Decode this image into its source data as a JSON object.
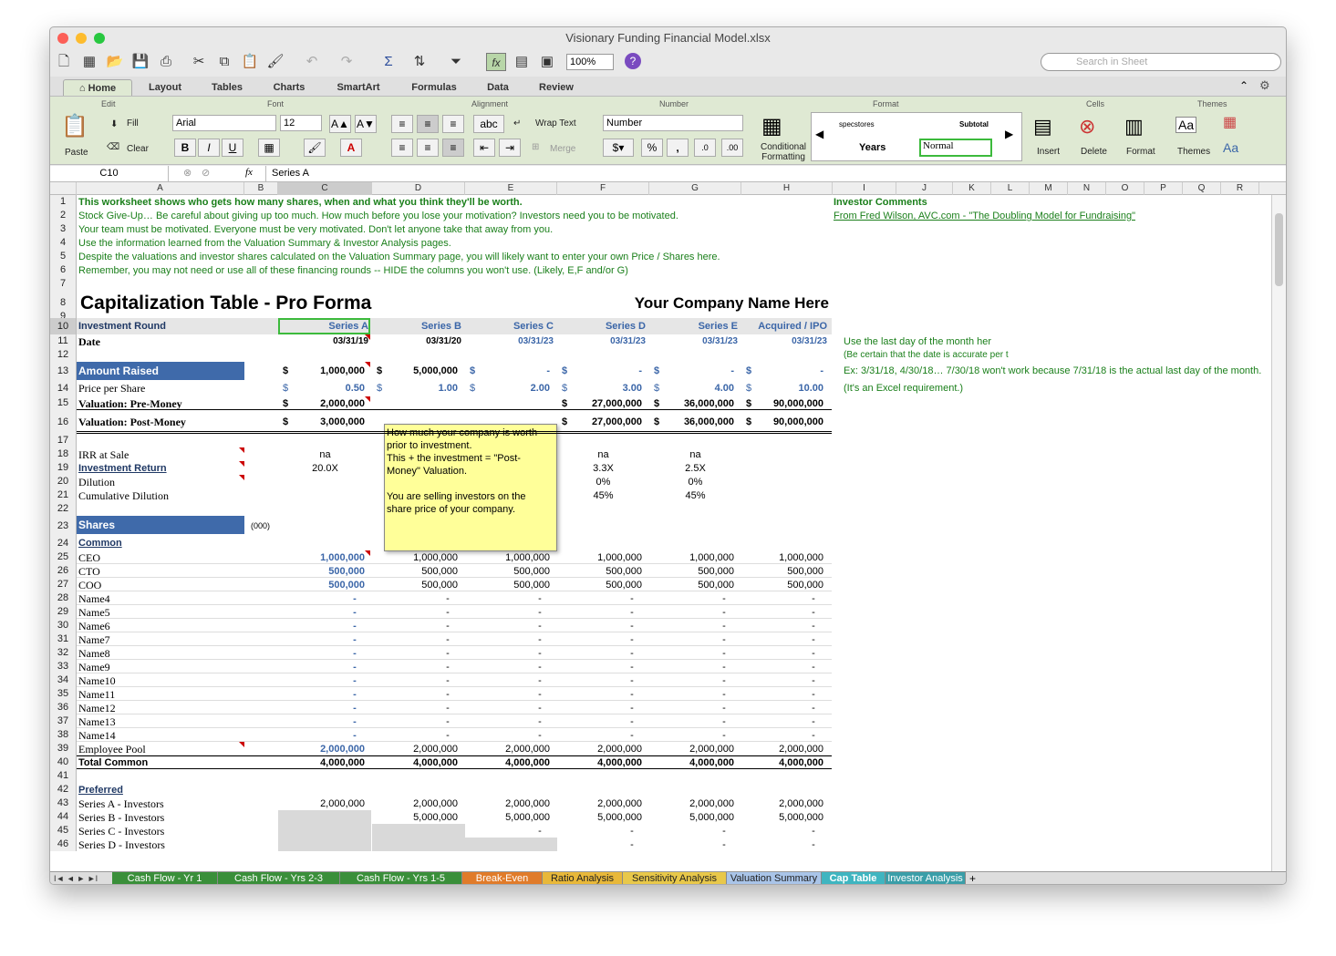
{
  "window": {
    "title": "Visionary Funding Financial Model.xlsx"
  },
  "toolbar": {
    "zoom": "100%",
    "search_placeholder": "Search in Sheet"
  },
  "tabs": [
    "Home",
    "Layout",
    "Tables",
    "Charts",
    "SmartArt",
    "Formulas",
    "Data",
    "Review"
  ],
  "ribbon": {
    "groups": {
      "edit": "Edit",
      "font": "Font",
      "alignment": "Alignment",
      "number": "Number",
      "format": "Format",
      "cells": "Cells",
      "themes": "Themes"
    },
    "paste": "Paste",
    "fill": "Fill",
    "clear": "Clear",
    "font_name": "Arial",
    "font_size": "12",
    "wrap_text": "Wrap Text",
    "merge": "Merge",
    "number_format": "Number",
    "cond_fmt": "Conditional Formatting",
    "styles": {
      "s1": "specstores",
      "s2": "Subtotal",
      "s3": "Years",
      "s4": "Normal"
    },
    "insert": "Insert",
    "delete": "Delete",
    "format": "Format",
    "themes": "Themes",
    "bold": "B",
    "italic": "I",
    "underline": "U",
    "abc": "abc",
    "pct": "%",
    "comma": ","
  },
  "formula": {
    "cell": "C10",
    "value": "Series A",
    "fx": "fx"
  },
  "columns": [
    "A",
    "B",
    "C",
    "D",
    "E",
    "F",
    "G",
    "H",
    "I",
    "J",
    "K",
    "L",
    "M",
    "N",
    "O",
    "P",
    "Q",
    "R"
  ],
  "rows": [
    "1",
    "2",
    "3",
    "4",
    "5",
    "6",
    "7",
    "8",
    "9",
    "10",
    "11",
    "12",
    "13",
    "14",
    "15",
    "16",
    "17",
    "18",
    "19",
    "20",
    "21",
    "22",
    "23",
    "24",
    "25",
    "26",
    "27",
    "28",
    "29",
    "30",
    "31",
    "32",
    "33",
    "34",
    "35",
    "36",
    "37",
    "38",
    "39",
    "40",
    "41",
    "42",
    "43",
    "44",
    "45",
    "46"
  ],
  "intro": {
    "l1": "This worksheet shows who gets how many shares, when and what you think they'll be worth.",
    "l2": "Stock Give-Up… Be careful about giving up too much. How much before you lose your motivation? Investors need you to be motivated.",
    "l3": "Your team must be motivated. Everyone must be very motivated. Don't let anyone take that away from you.",
    "l4": "Use the information learned from the Valuation Summary & Investor Analysis pages.",
    "l5": "Despite the valuations and investor shares calculated on the Valuation Summary page, you will likely want to enter your own Price / Shares here.",
    "l6": "Remember, you may not need or use all of these financing rounds -- HIDE the columns you won't use. (Likely, E,F and/or G)"
  },
  "comments": {
    "title": "Investor Comments",
    "link": "From Fred Wilson, AVC.com - \"The Doubling Model for Fundraising\"",
    "n1": "Use the last day of the month her",
    "n2": "(Be certain that the date is accurate per t",
    "n3": "Ex: 3/31/18, 4/30/18… 7/30/18 won't work because 7/31/18 is the actual last day of the month.",
    "n4": "(It's an Excel requirement.)"
  },
  "table": {
    "title": "Capitalization Table - Pro Forma",
    "company": "Your Company Name Here",
    "round_label": "Investment Round",
    "rounds": [
      "Series A",
      "Series B",
      "Series C",
      "Series D",
      "Series E",
      "Acquired / IPO"
    ],
    "date_label": "Date",
    "dates": [
      "03/31/19",
      "03/31/20",
      "03/31/23",
      "03/31/23",
      "03/31/23",
      "03/31/23"
    ],
    "amount_label": "Amount Raised",
    "amounts": [
      "1,000,000",
      "5,000,000",
      "-",
      "-",
      "-",
      "-"
    ],
    "price_label": "Price per Share",
    "prices": [
      "0.50",
      "1.00",
      "2.00",
      "3.00",
      "4.00",
      "10.00"
    ],
    "pre_label": "Valuation: Pre-Money",
    "pre": [
      "2,000,000",
      "",
      "",
      "27,000,000",
      "36,000,000",
      "90,000,000"
    ],
    "post_label": "Valuation: Post-Money",
    "post": [
      "3,000,000",
      "",
      "",
      "27,000,000",
      "36,000,000",
      "90,000,000"
    ],
    "dollar": "$",
    "irr_label": "IRR at Sale",
    "irr": [
      "na",
      "",
      "",
      "na",
      "na",
      ""
    ],
    "ret_label": "Investment Return",
    "ret": [
      "20.0X",
      "",
      "",
      "3.3X",
      "2.5X",
      ""
    ],
    "dil_label": "Dilution",
    "dil": [
      "",
      "",
      "",
      "0%",
      "0%",
      ""
    ],
    "cdil_label": "Cumulative Dilution",
    "cdil": [
      "",
      "",
      "",
      "45%",
      "45%",
      ""
    ],
    "shares_label": "Shares",
    "units": "(000)",
    "common_label": "Common",
    "common": [
      {
        "name": "CEO",
        "v": [
          "1,000,000",
          "1,000,000",
          "1,000,000",
          "1,000,000",
          "1,000,000",
          "1,000,000"
        ]
      },
      {
        "name": "CTO",
        "v": [
          "500,000",
          "500,000",
          "500,000",
          "500,000",
          "500,000",
          "500,000"
        ]
      },
      {
        "name": "COO",
        "v": [
          "500,000",
          "500,000",
          "500,000",
          "500,000",
          "500,000",
          "500,000"
        ]
      },
      {
        "name": "Name4",
        "v": [
          "-",
          "-",
          "-",
          "-",
          "-",
          "-"
        ]
      },
      {
        "name": "Name5",
        "v": [
          "-",
          "-",
          "-",
          "-",
          "-",
          "-"
        ]
      },
      {
        "name": "Name6",
        "v": [
          "-",
          "-",
          "-",
          "-",
          "-",
          "-"
        ]
      },
      {
        "name": "Name7",
        "v": [
          "-",
          "-",
          "-",
          "-",
          "-",
          "-"
        ]
      },
      {
        "name": "Name8",
        "v": [
          "-",
          "-",
          "-",
          "-",
          "-",
          "-"
        ]
      },
      {
        "name": "Name9",
        "v": [
          "-",
          "-",
          "-",
          "-",
          "-",
          "-"
        ]
      },
      {
        "name": "Name10",
        "v": [
          "-",
          "-",
          "-",
          "-",
          "-",
          "-"
        ]
      },
      {
        "name": "Name11",
        "v": [
          "-",
          "-",
          "-",
          "-",
          "-",
          "-"
        ]
      },
      {
        "name": "Name12",
        "v": [
          "-",
          "-",
          "-",
          "-",
          "-",
          "-"
        ]
      },
      {
        "name": "Name13",
        "v": [
          "-",
          "-",
          "-",
          "-",
          "-",
          "-"
        ]
      },
      {
        "name": "Name14",
        "v": [
          "-",
          "-",
          "-",
          "-",
          "-",
          "-"
        ]
      },
      {
        "name": "Employee Pool",
        "v": [
          "2,000,000",
          "2,000,000",
          "2,000,000",
          "2,000,000",
          "2,000,000",
          "2,000,000"
        ]
      }
    ],
    "total_common_label": "Total Common",
    "total_common": [
      "4,000,000",
      "4,000,000",
      "4,000,000",
      "4,000,000",
      "4,000,000",
      "4,000,000"
    ],
    "preferred_label": "Preferred",
    "preferred": [
      {
        "name": "Series A - Investors",
        "v": [
          "2,000,000",
          "2,000,000",
          "2,000,000",
          "2,000,000",
          "2,000,000",
          "2,000,000"
        ]
      },
      {
        "name": "Series B - Investors",
        "v": [
          "",
          "5,000,000",
          "5,000,000",
          "5,000,000",
          "5,000,000",
          "5,000,000"
        ]
      },
      {
        "name": "Series C - Investors",
        "v": [
          "",
          "",
          "-",
          "-",
          "-",
          "-"
        ]
      },
      {
        "name": "Series D - Investors",
        "v": [
          "",
          "",
          "",
          "-",
          "-",
          "-"
        ]
      }
    ]
  },
  "tooltip": {
    "l1": "How much your company is worth",
    "l2": "prior to investment.",
    "l3": "This + the investment = \"Post-",
    "l4": "Money\" Valuation.",
    "l5": "You are selling investors on the",
    "l6": "share price of your company."
  },
  "sheet_tabs": [
    {
      "label": "Cash Flow - Yr 1",
      "color": "#3a8f3a"
    },
    {
      "label": "Cash Flow - Yrs 2-3",
      "color": "#3a8f3a"
    },
    {
      "label": "Cash Flow - Yrs 1-5",
      "color": "#3a8f3a"
    },
    {
      "label": "Break-Even",
      "color": "#e07b2a"
    },
    {
      "label": "Ratio Analysis",
      "color": "#e8b83a"
    },
    {
      "label": "Sensitivity Analysis",
      "color": "#e8c84a"
    },
    {
      "label": "Valuation Summary",
      "color": "#a9c4e8"
    },
    {
      "label": "Cap Table",
      "color": "#3fb5c0"
    },
    {
      "label": "Investor Analysis",
      "color": "#3a9ea8"
    }
  ],
  "sheet_nav": "I◄ ◄ ► ►I"
}
